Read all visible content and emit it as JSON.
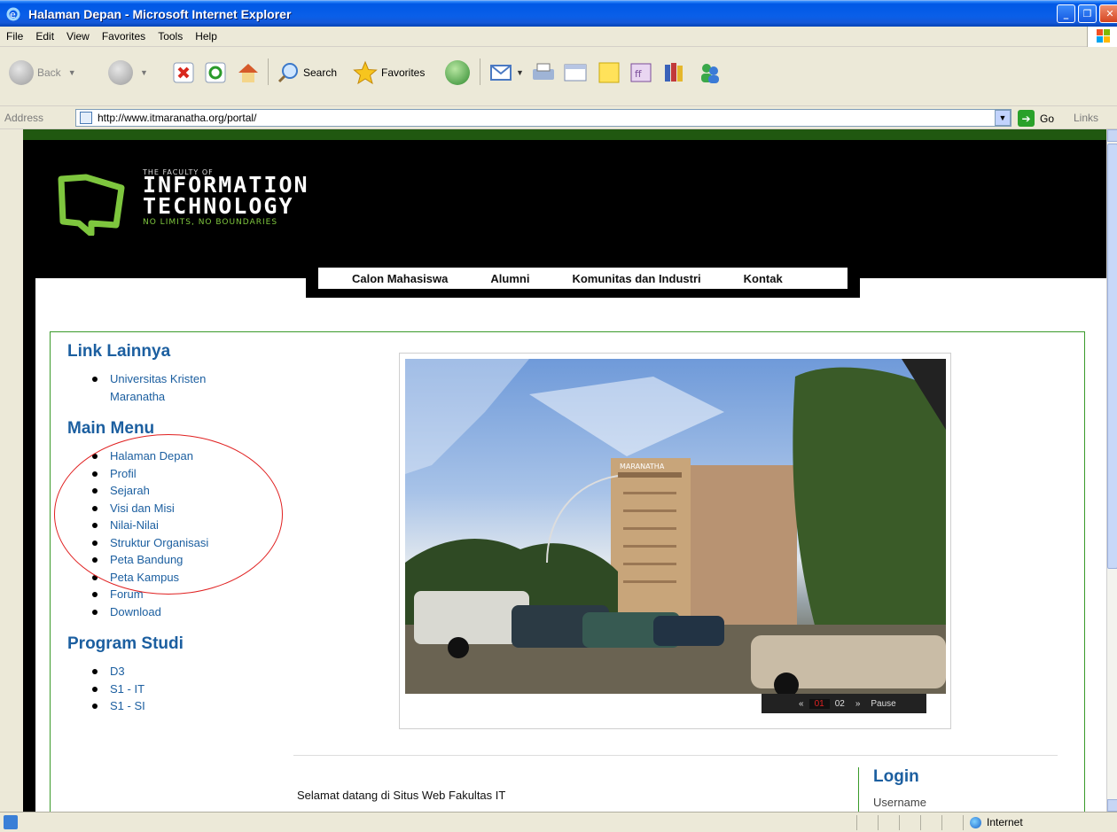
{
  "window": {
    "title": "Halaman Depan - Microsoft Internet Explorer",
    "app_icon": "ie-icon",
    "buttons": [
      "minimize-button",
      "maximize-button",
      "close-button"
    ]
  },
  "menubar": [
    "File",
    "Edit",
    "View",
    "Favorites",
    "Tools",
    "Help"
  ],
  "toolbar": {
    "back_label": "Back",
    "search_label": "Search",
    "favorites_label": "Favorites"
  },
  "address": {
    "label": "Address",
    "url": "http://www.itmaranatha.org/portal/",
    "go_label": "Go",
    "links_label": "Links"
  },
  "site": {
    "logo": {
      "line1": "THE FACULTY OF",
      "line2": "INFORMATION",
      "line3": "TECHNOLOGY",
      "tagline": "NO LIMITS, NO BOUNDARIES"
    },
    "nav": [
      "Calon Mahasiswa",
      "Alumni",
      "Komunitas dan Industri",
      "Kontak"
    ],
    "sidebar": {
      "link_lainnya": {
        "title": "Link Lainnya",
        "items": [
          "Universitas Kristen Maranatha"
        ]
      },
      "main_menu": {
        "title": "Main Menu",
        "items": [
          "Halaman Depan",
          "Profil",
          "Sejarah",
          "Visi dan Misi",
          "Nilai-Nilai",
          "Struktur Organisasi",
          "Peta Bandung",
          "Peta Kampus",
          "Forum",
          "Download"
        ]
      },
      "program_studi": {
        "title": "Program Studi",
        "items": [
          "D3",
          "S1 - IT",
          "S1 - SI"
        ]
      }
    },
    "slideshow": {
      "prev": "«",
      "slide1": "01",
      "slide2": "02",
      "next": "»",
      "pause": "Pause",
      "building_sign": "MARANATHA"
    },
    "welcome_text": "Selamat datang di Situs Web Fakultas IT",
    "login": {
      "title": "Login",
      "username_label": "Username"
    }
  },
  "statusbar": {
    "zone": "Internet"
  },
  "colors": {
    "title_blue": "#0a5fe8",
    "site_green": "#7ec63e",
    "link_blue": "#1c5fa0",
    "annotation_red": "#e02020"
  }
}
